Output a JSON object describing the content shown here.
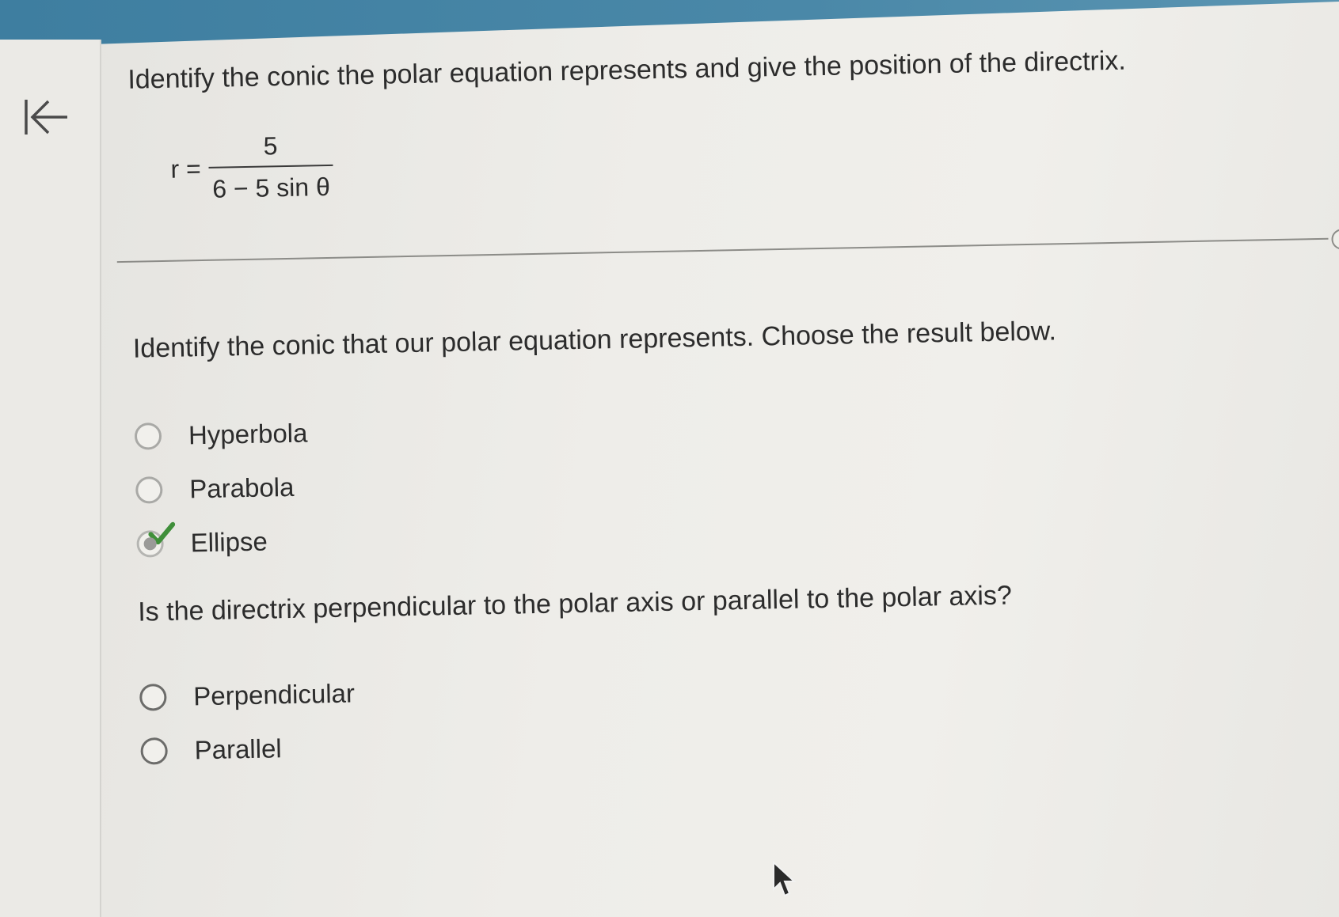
{
  "navigation": {
    "back_icon": "first-page-arrow-icon"
  },
  "problem": {
    "question": "Identify the conic the polar equation represents and give the position of the directrix.",
    "equation": {
      "lhs": "r =",
      "numerator": "5",
      "denominator": "6 − 5 sin θ"
    }
  },
  "step1": {
    "question": "Identify the conic that our polar equation represents.  Choose the result below.",
    "options": [
      {
        "label": "Hyperbola",
        "selected": false
      },
      {
        "label": "Parabola",
        "selected": false
      },
      {
        "label": "Ellipse",
        "selected": true,
        "correct": true
      }
    ]
  },
  "step2": {
    "question": "Is the directrix perpendicular to the polar axis or parallel to the polar axis?",
    "options": [
      {
        "label": "Perpendicular",
        "selected": false
      },
      {
        "label": "Parallel",
        "selected": false
      }
    ]
  },
  "colors": {
    "top_bar": "#3e7ea0",
    "check": "#3f8f3a",
    "background": "#eeede9"
  }
}
